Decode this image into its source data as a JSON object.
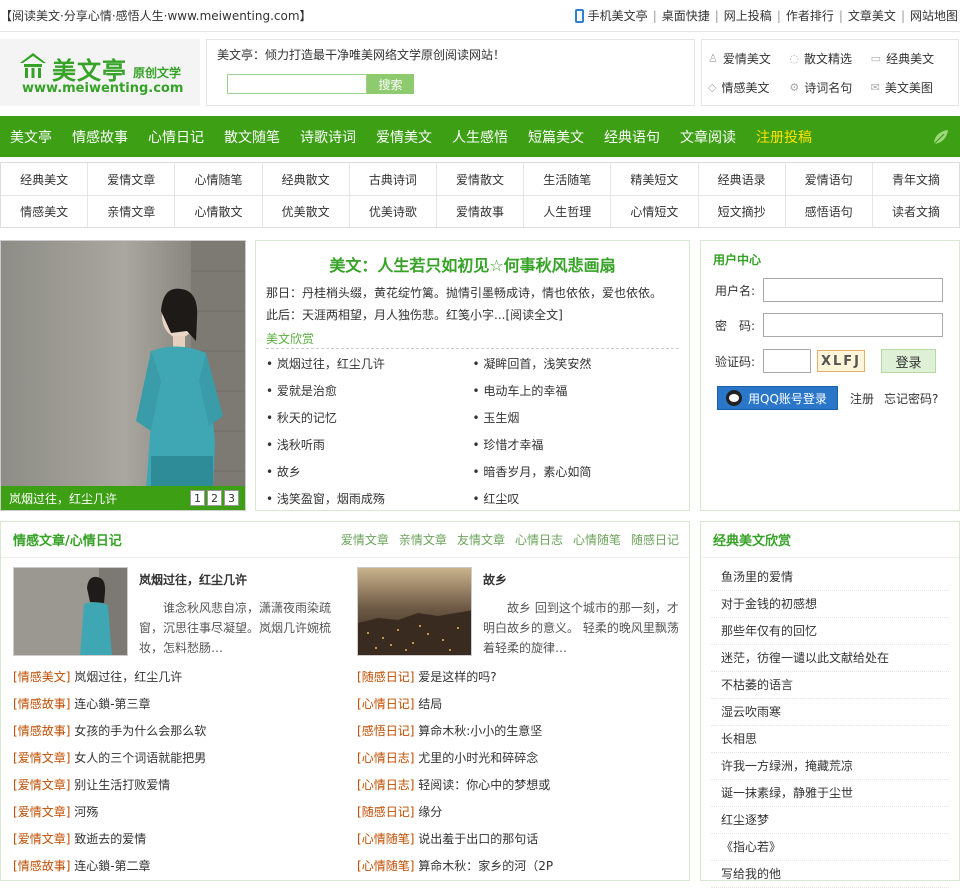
{
  "topbar": {
    "tagline": "【阅读美文·分享心情·感悟人生·www.meiwenting.com】",
    "links": [
      "手机美文亭",
      "桌面快捷",
      "网上投稿",
      "作者排行",
      "文章美文",
      "网站地图"
    ]
  },
  "header": {
    "logo_name": "美文亭",
    "logo_sub": "原创文学",
    "logo_url": "www.meiwenting.com",
    "slogan": "美文亭：倾力打造最干净唯美网络文学原创阅读网站！",
    "search_value": "",
    "search_button": "搜索",
    "quick_links": [
      "爱情美文",
      "散文精选",
      "经典美文",
      "情感美文",
      "诗词名句",
      "美文美图"
    ]
  },
  "nav": {
    "items": [
      "美文亭",
      "情感故事",
      "心情日记",
      "散文随笔",
      "诗歌诗词",
      "爱情美文",
      "人生感悟",
      "短篇美文",
      "经典语句",
      "文章阅读"
    ],
    "highlight": "注册投稿"
  },
  "subnav": {
    "row1": [
      "经典美文",
      "爱情文章",
      "心情随笔",
      "经典散文",
      "古典诗词",
      "爱情散文",
      "生活随笔",
      "精美短文",
      "经典语录",
      "爱情语句",
      "青年文摘"
    ],
    "row2": [
      "情感美文",
      "亲情文章",
      "心情散文",
      "优美散文",
      "优美诗歌",
      "爱情故事",
      "人生哲理",
      "心情短文",
      "短文摘抄",
      "感悟语句",
      "读者文摘"
    ]
  },
  "slideshow": {
    "caption": "岚烟过往，红尘几许",
    "pages": [
      "1",
      "2",
      "3"
    ]
  },
  "feature": {
    "title": "美文：人生若只如初见☆何事秋风悲画扇",
    "summary1": "那日：丹桂梢头缀，黄花绽竹篱。抛情引墨畅成诗，情也依依，爱也依依。",
    "summary2": "此后：天涯两相望，月人独伤悲。红笺小字...",
    "more": "[阅读全文]",
    "label": "美文欣赏",
    "items": [
      "岚烟过往，红尘几许",
      "凝眸回首，浅笑安然",
      "爱就是治愈",
      "电动车上的幸福",
      "秋天的记忆",
      "玉生烟",
      "浅秋听雨",
      "珍惜才幸福",
      "故乡",
      "暗香岁月，素心如简",
      "浅笑盈窗，烟雨成殇",
      "红尘叹"
    ]
  },
  "user_center": {
    "title": "用户中心",
    "username_label": "用户名:",
    "password_label": "密　码:",
    "captcha_label": "验证码:",
    "captcha_text": "XLFJ",
    "login_button": "登录",
    "qq_login": "用QQ账号登录",
    "register": "注册",
    "forgot": "忘记密码?"
  },
  "section_emotion": {
    "title": "情感文章/心情日记",
    "tabs": [
      "爱情文章",
      "亲情文章",
      "友情文章",
      "心情日志",
      "心情随笔",
      "随感日记"
    ],
    "pic1_title": "岚烟过往，红尘几许",
    "pic1_text": "谁念秋风悲自凉，潇潇夜雨染疏窗，沉思往事尽凝望。岚烟几许婉梳妆，怎料愁肠…",
    "pic2_title": "故乡",
    "pic2_text": "故乡 回到这个城市的那一刻，才明白故乡的意义。 轻柔的晚风里飘荡着轻柔的旋律…",
    "left_list": [
      {
        "cat": "情感美文",
        "title": "岚烟过往，红尘几许"
      },
      {
        "cat": "情感故事",
        "title": "连心鎖-第三章"
      },
      {
        "cat": "情感故事",
        "title": "女孩的手为什么会那么软"
      },
      {
        "cat": "爱情文章",
        "title": "女人的三个词语就能把男"
      },
      {
        "cat": "爱情文章",
        "title": "别让生活打败爱情"
      },
      {
        "cat": "爱情文章",
        "title": "河殇"
      },
      {
        "cat": "爱情文章",
        "title": "致逝去的爱情"
      },
      {
        "cat": "情感故事",
        "title": "连心鎖-第二章"
      }
    ],
    "right_list": [
      {
        "cat": "随感日记",
        "title": "爱是这样的吗?"
      },
      {
        "cat": "心情日记",
        "title": "结局"
      },
      {
        "cat": "感悟日记",
        "title": "算命木秋:小小的生意坚"
      },
      {
        "cat": "心情日志",
        "title": "尤里的小时光和碎碎念"
      },
      {
        "cat": "心情日志",
        "title": "轻阅读：你心中的梦想或"
      },
      {
        "cat": "随感日记",
        "title": "缘分"
      },
      {
        "cat": "心情随笔",
        "title": "说出羞于出口的那句话"
      },
      {
        "cat": "心情随笔",
        "title": "算命木秋：家乡的河（2P"
      }
    ]
  },
  "section_classic": {
    "title": "经典美文欣赏",
    "items": [
      "鱼汤里的爱情",
      "对于金钱的初感想",
      "那些年仅有的回忆",
      "迷茫，彷徨一谴以此文献给处在",
      "不枯萎的语言",
      "湿云吹雨寒",
      "长相思",
      "许我一方绿洲，掩藏荒凉",
      "诞一抹素绿，静雅于尘世",
      "红尘逐梦",
      "《指心若》",
      "写给我的他"
    ]
  },
  "colors": {
    "brand_green": "#3c9f14",
    "category_orange": "#c04d00"
  }
}
